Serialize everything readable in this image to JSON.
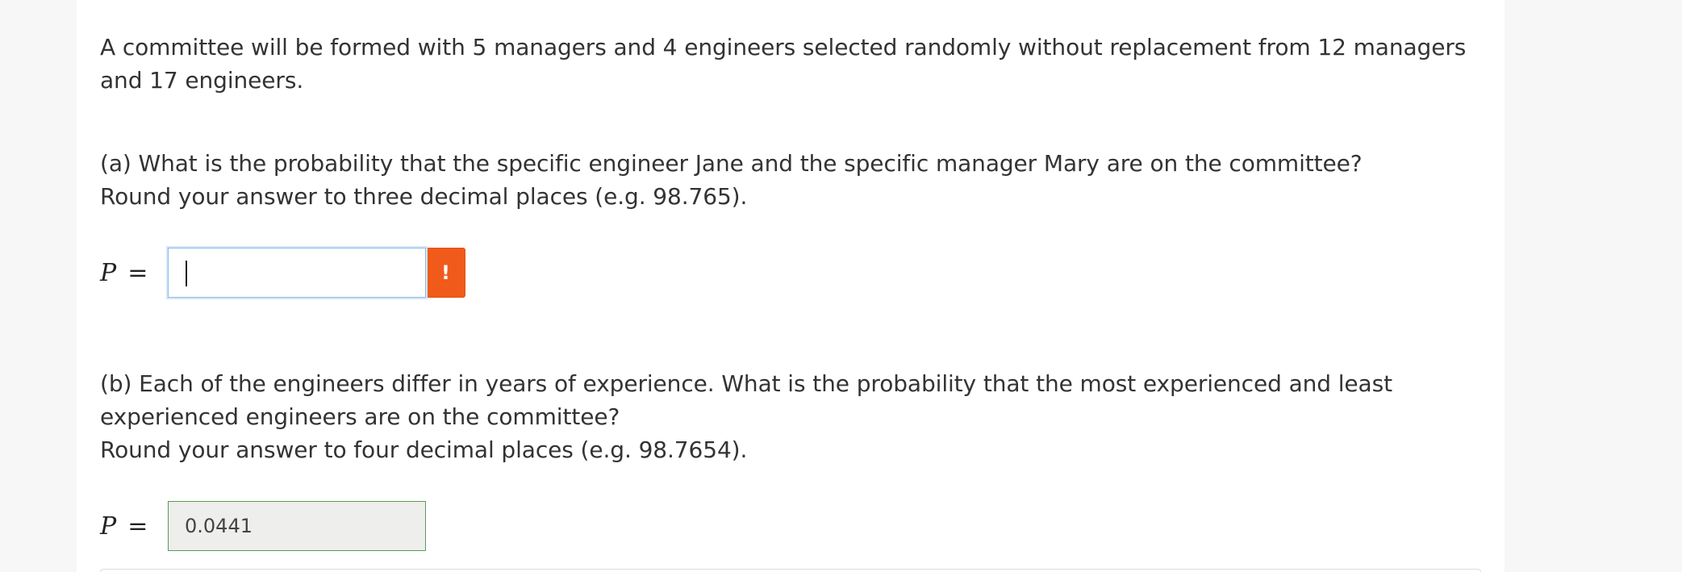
{
  "question": {
    "intro": "A committee will be formed with 5 managers and 4 engineers selected randomly without replacement from 12 managers and 17 engineers.",
    "part_a": {
      "prompt": "(a) What is the probability that the specific engineer Jane and the specific manager Mary are on the committee?",
      "instruction": "Round your answer to three decimal places (e.g. 98.765).",
      "variable": "P",
      "equals": "=",
      "answer_value": "",
      "alert_glyph": "!",
      "alert_color": "#f05a1a",
      "alert_icon": "exclamation-icon"
    },
    "part_b": {
      "prompt": "(b) Each of the engineers differ in years of experience. What is the probability that the most experienced and least experienced engineers are on the committee?",
      "instruction": "Round your answer to four decimal places (e.g. 98.7654).",
      "variable": "P",
      "equals": "=",
      "answer_value": "0.0441",
      "status_color": "#5a9a5a"
    }
  }
}
